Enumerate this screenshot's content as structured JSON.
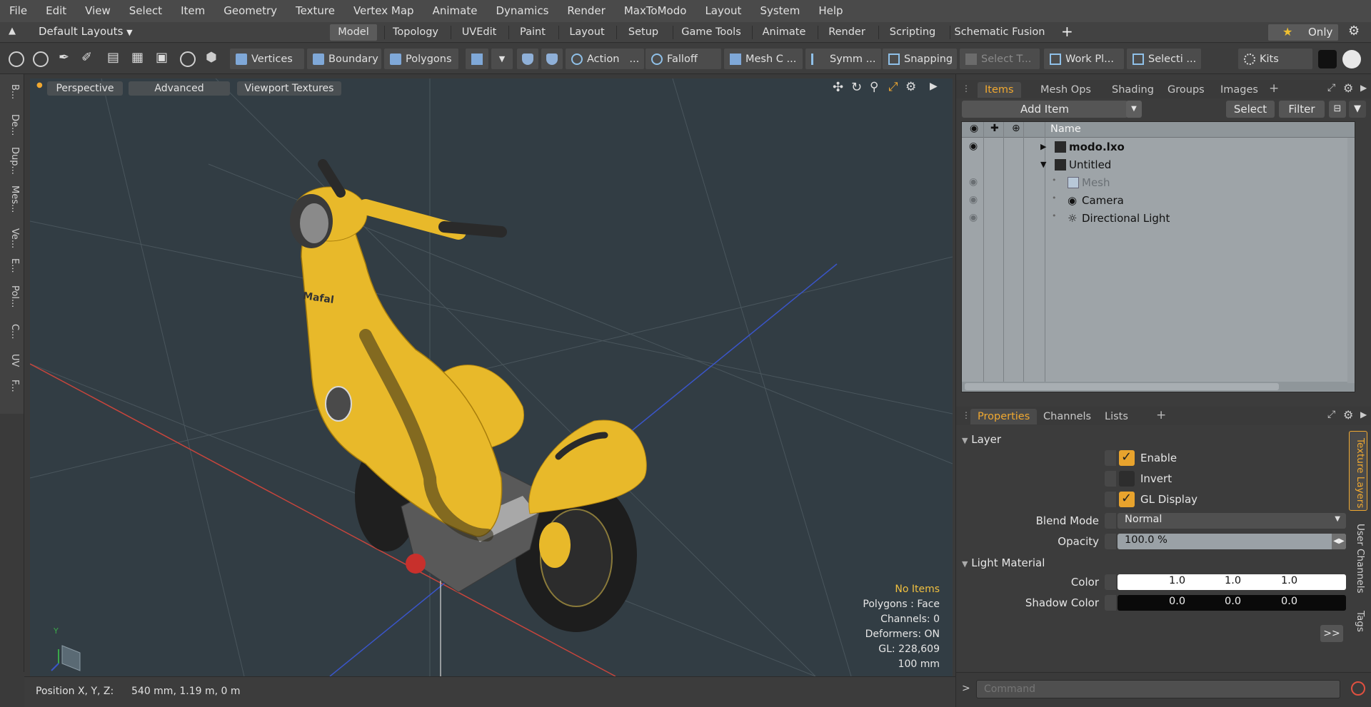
{
  "menu": [
    "File",
    "Edit",
    "View",
    "Select",
    "Item",
    "Geometry",
    "Texture",
    "Vertex Map",
    "Animate",
    "Dynamics",
    "Render",
    "MaxToModo",
    "Layout",
    "System",
    "Help"
  ],
  "layout_selector": "Default Layouts",
  "layout_tabs": [
    "Model",
    "Topology",
    "UVEdit",
    "Paint",
    "Layout",
    "Setup",
    "Game Tools",
    "Animate",
    "Render",
    "Scripting",
    "Schematic Fusion"
  ],
  "active_layout_tab": "Model",
  "only_label": "Only",
  "toolbar": {
    "vertices": "Vertices",
    "boundary": "Boundary",
    "polygons": "Polygons",
    "action": "Action",
    "action_more": "...",
    "falloff": "Falloff",
    "mesh_constraint": "Mesh C ...",
    "symmetry": "Symm ...",
    "snapping": "Snapping",
    "select_through": "Select T...",
    "work_plane": "Work Pl...",
    "selection_sets": "Selecti ...",
    "kits": "Kits"
  },
  "left_tabs": [
    "B...",
    "De...",
    "Dup...",
    "Mes...",
    "Ve...",
    "E...",
    "Pol...",
    "C...",
    "UV",
    "F..."
  ],
  "viewport": {
    "view_mode": "Perspective",
    "shading": "Advanced",
    "textures": "Viewport Textures",
    "stats_title": "No Items",
    "stats": [
      "Polygons : Face",
      "Channels: 0",
      "Deformers: ON",
      "GL: 228,609",
      "100 mm"
    ],
    "model_badge": "Mafal",
    "axis_y": "Y"
  },
  "status_bar": {
    "position_label": "Position X, Y, Z:",
    "position_value": "540 mm, 1.19 m, 0 m"
  },
  "items_panel": {
    "tabs": [
      "Items",
      "Mesh Ops",
      "Shading",
      "Groups",
      "Images"
    ],
    "active_tab": "Items",
    "add_item": "Add Item",
    "select_btn": "Select",
    "filter_btn": "Filter",
    "col_name": "Name",
    "items": [
      {
        "name": "modo.lxo",
        "level": 0,
        "bold": true,
        "expand": "collapsed",
        "visible": true
      },
      {
        "name": "Untitled",
        "level": 0,
        "bold": false,
        "expand": "expanded",
        "visible": false
      },
      {
        "name": "Mesh",
        "level": 1,
        "bold": false,
        "expand": "none",
        "visible": true,
        "dimmed": true
      },
      {
        "name": "Camera",
        "level": 1,
        "bold": false,
        "expand": "none",
        "visible": true
      },
      {
        "name": "Directional Light",
        "level": 1,
        "bold": false,
        "expand": "none",
        "visible": true
      }
    ]
  },
  "properties_panel": {
    "tabs": [
      "Properties",
      "Channels",
      "Lists"
    ],
    "active_tab": "Properties",
    "layer_section": "Layer",
    "enable": {
      "label": "Enable",
      "checked": true
    },
    "invert": {
      "label": "Invert",
      "checked": false
    },
    "gl_display": {
      "label": "GL Display",
      "checked": true
    },
    "blend_mode": {
      "label": "Blend Mode",
      "value": "Normal"
    },
    "opacity": {
      "label": "Opacity",
      "value": "100.0 %"
    },
    "light_material_section": "Light Material",
    "color": {
      "label": "Color",
      "values": [
        "1.0",
        "1.0",
        "1.0"
      ]
    },
    "shadow_color": {
      "label": "Shadow Color",
      "values": [
        "0.0",
        "0.0",
        "0.0"
      ]
    },
    "more_btn": ">>",
    "side_tabs": [
      "Texture Layers",
      "User Channels",
      "Tags"
    ]
  },
  "command": {
    "placeholder": "Command",
    "prompt": ">"
  },
  "colors": {
    "accent": "#f0a830",
    "viewport_bg": "#323d44",
    "panel_bg": "#3c3c3c",
    "list_bg": "#9ea4a8",
    "scooter_yellow": "#e8b92a"
  }
}
